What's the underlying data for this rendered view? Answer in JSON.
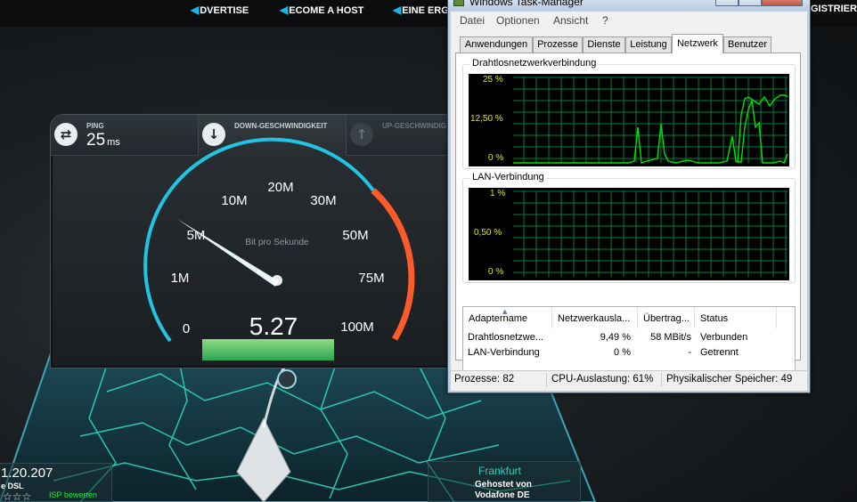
{
  "nav": {
    "items": [
      {
        "label": "DVERTISE"
      },
      {
        "label": "ECOME A HOST"
      },
      {
        "label": "EINE ERG"
      },
      {
        "label": "GISTRIERE"
      }
    ]
  },
  "speedtest": {
    "ping": {
      "label": "PING",
      "value": "25",
      "unit": "ms"
    },
    "download": {
      "label": "DOWN-GESCHWINDIGKEIT"
    },
    "upload": {
      "label": "UP-GESCHWINDIG"
    },
    "gauge": {
      "unit_label": "Bit pro Sekunde",
      "reading": "5.27",
      "ticks": [
        "0",
        "1M",
        "5M",
        "10M",
        "20M",
        "30M",
        "50M",
        "75M",
        "100M"
      ]
    },
    "ip": "1.20.207",
    "isp_line": "e DSL",
    "isp_rate_label": "ISP bewerten",
    "server": {
      "city": "Frankfurt",
      "hosted_by": "Gehostet von",
      "host": "Vodafone DE"
    }
  },
  "taskmanager": {
    "title": "Windows Task-Manager",
    "menu": [
      "Datei",
      "Optionen",
      "Ansicht",
      "?"
    ],
    "tabs": [
      "Anwendungen",
      "Prozesse",
      "Dienste",
      "Leistung",
      "Netzwerk",
      "Benutzer"
    ],
    "active_tab": "Netzwerk",
    "graphs": [
      {
        "title": "Drahtlosnetzwerkverbindung",
        "y_labels": [
          "25 %",
          "12,50 %",
          "0 %"
        ]
      },
      {
        "title": "LAN-Verbindung",
        "y_labels": [
          "1 %",
          "0,50 %",
          "0 %"
        ]
      }
    ],
    "table": {
      "headers": [
        "Adaptername",
        "Netzwerkausla...",
        "Übertrag...",
        "Status"
      ],
      "rows": [
        [
          "Drahtlosnetzwe...",
          "9,49 %",
          "58 MBit/s",
          "Verbunden"
        ],
        [
          "LAN-Verbindung",
          "0 %",
          "-",
          "Getrennt"
        ]
      ]
    },
    "status": {
      "processes": "Prozesse: 82",
      "cpu": "CPU-Auslastung: 61%",
      "memory": "Physikalischer Speicher: 49"
    }
  },
  "colors": {
    "accent_cyan": "#1ec8e8",
    "gauge_red": "#ff5a2a",
    "graph_green": "#00c800",
    "graph_grid": "#008040"
  }
}
